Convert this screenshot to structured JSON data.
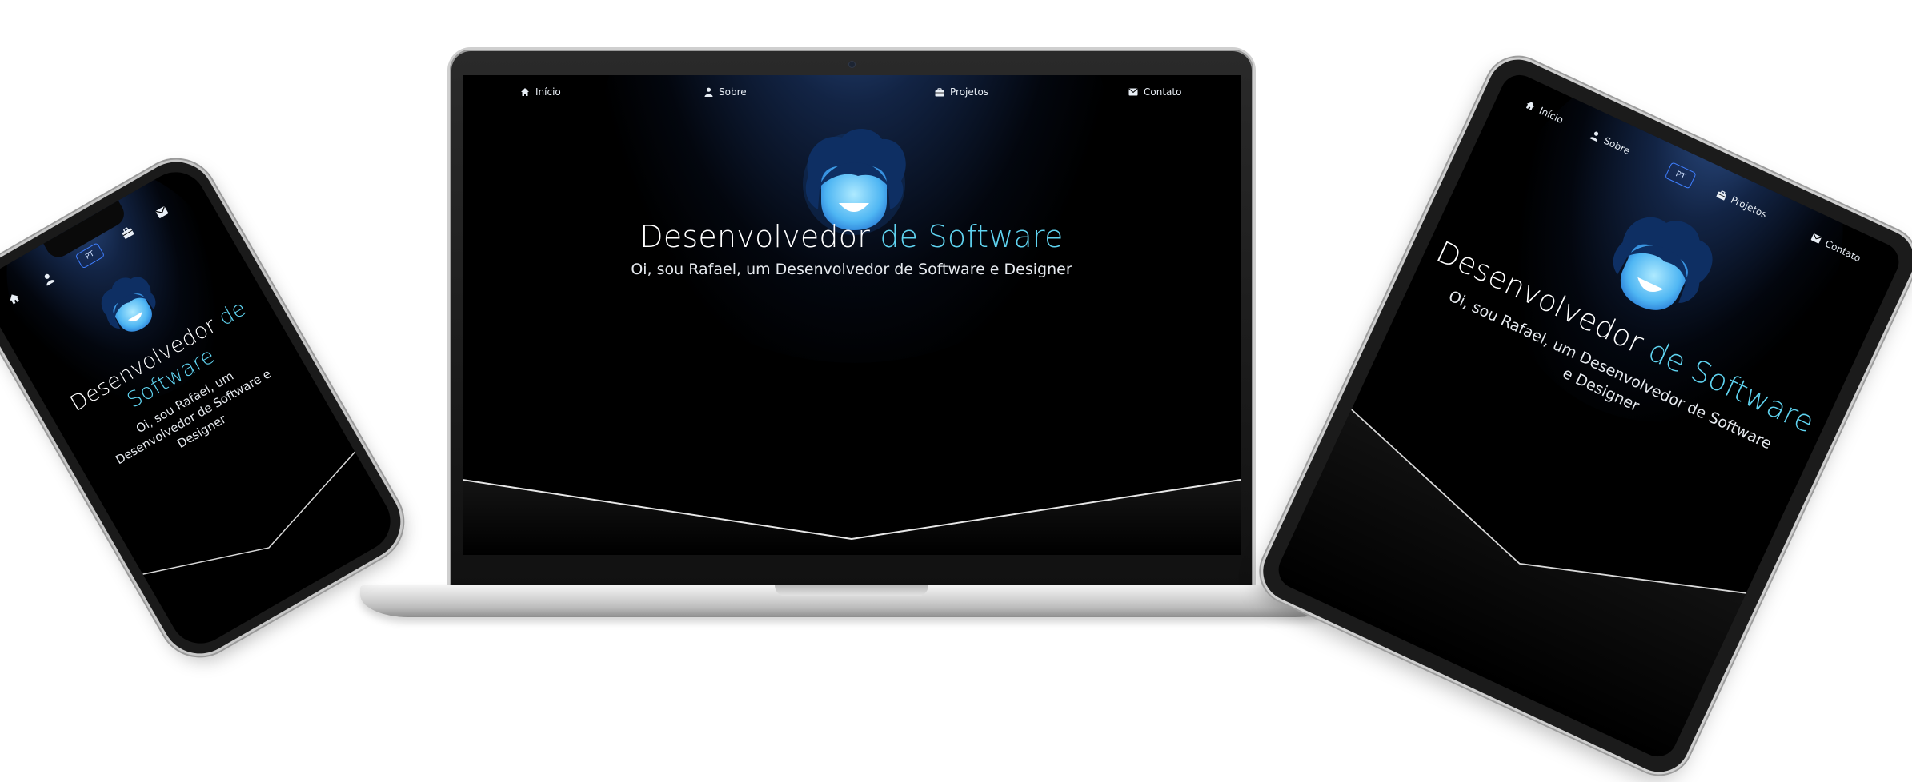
{
  "nav": {
    "inicio": "Início",
    "sobre": "Sobre",
    "projetos": "Projetos",
    "contato": "Contato",
    "lang": "PT"
  },
  "hero": {
    "title_start": "Desenvolvedor ",
    "title_accent": "de Software",
    "subtitle": "Oi, sou Rafael, um Desenvolvedor de Software e Designer"
  },
  "icons": {
    "home": "home-icon",
    "user": "user-icon",
    "briefcase": "briefcase-icon",
    "mail": "mail-icon"
  },
  "colors": {
    "accent": "#5fd3f0",
    "glow": "#3a64aa",
    "face": "#7ad8ff",
    "hair": "#0e2f63",
    "lang_border": "#3f7fff"
  }
}
